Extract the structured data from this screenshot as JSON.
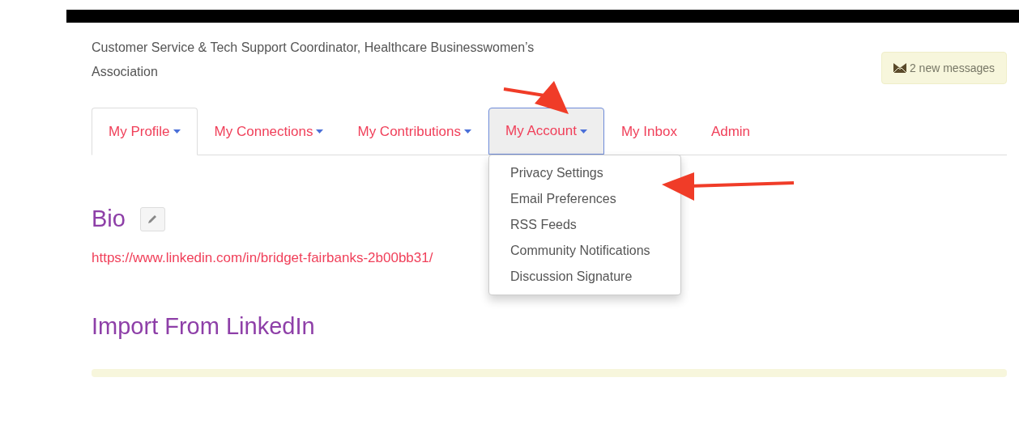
{
  "header": {
    "organization": "Customer Service & Tech Support Coordinator, Healthcare Businesswomen’s Association",
    "messages": "2 new messages"
  },
  "tabs": [
    {
      "label": "My Profile",
      "dropdown": true,
      "selected": true,
      "open": false
    },
    {
      "label": "My Connections",
      "dropdown": true,
      "selected": false,
      "open": false
    },
    {
      "label": "My Contributions",
      "dropdown": true,
      "selected": false,
      "open": false
    },
    {
      "label": "My Account",
      "dropdown": true,
      "selected": false,
      "open": true
    },
    {
      "label": "My Inbox",
      "dropdown": false,
      "selected": false,
      "open": false
    },
    {
      "label": "Admin",
      "dropdown": false,
      "selected": false,
      "open": false
    }
  ],
  "account_menu": [
    "Privacy Settings",
    "Email Preferences",
    "RSS Feeds",
    "Community Notifications",
    "Discussion Signature"
  ],
  "bio": {
    "heading": "Bio",
    "link": "https://www.linkedin.com/in/bridget-fairbanks-2b00bb31/"
  },
  "import": {
    "heading": "Import From LinkedIn"
  }
}
